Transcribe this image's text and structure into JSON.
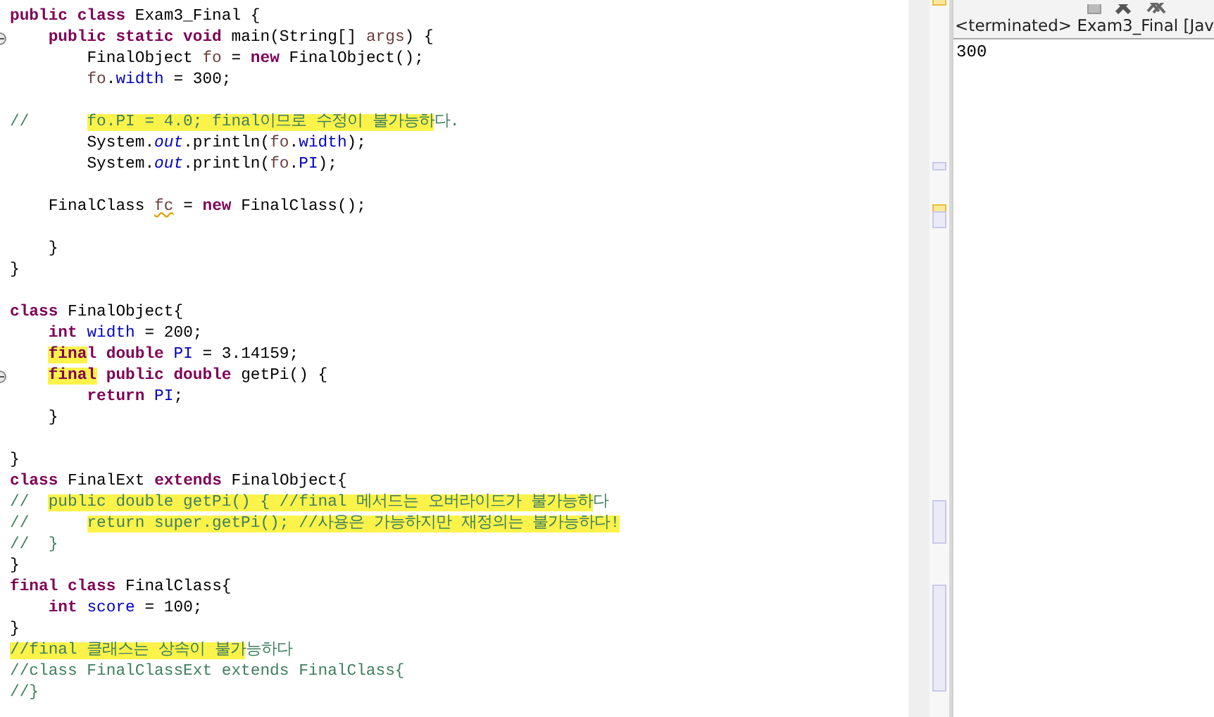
{
  "editor": {
    "lines": [
      {
        "kind": "code",
        "fold": false,
        "segments": [
          {
            "kind": "keyword",
            "text": "public class",
            "highlighted": false
          },
          {
            "kind": "plain",
            "text": " Exam3_Final {",
            "highlighted": false
          }
        ]
      },
      {
        "kind": "code",
        "fold": true,
        "segments": [
          {
            "kind": "keyword",
            "text": "    public static void",
            "highlighted": false
          },
          {
            "kind": "plain",
            "text": " main(String[] ",
            "highlighted": false
          },
          {
            "kind": "local",
            "text": "args",
            "highlighted": false
          },
          {
            "kind": "plain",
            "text": ") {",
            "highlighted": false
          }
        ]
      },
      {
        "kind": "code",
        "fold": false,
        "segments": [
          {
            "kind": "plain",
            "text": "        FinalObject ",
            "highlighted": false
          },
          {
            "kind": "local",
            "text": "fo",
            "highlighted": false
          },
          {
            "kind": "plain",
            "text": " = ",
            "highlighted": false
          },
          {
            "kind": "keyword",
            "text": "new",
            "highlighted": false
          },
          {
            "kind": "plain",
            "text": " FinalObject();",
            "highlighted": false
          }
        ]
      },
      {
        "kind": "code",
        "fold": false,
        "segments": [
          {
            "kind": "local",
            "text": "        fo",
            "highlighted": false
          },
          {
            "kind": "plain",
            "text": ".",
            "highlighted": false
          },
          {
            "kind": "field",
            "text": "width",
            "highlighted": false
          },
          {
            "kind": "plain",
            "text": " = 300;",
            "highlighted": false
          }
        ]
      },
      {
        "kind": "blank"
      },
      {
        "kind": "code",
        "fold": false,
        "segments": [
          {
            "kind": "comment",
            "text": "//",
            "highlighted": false
          },
          {
            "kind": "comment",
            "text": "      fo.PI = 4.0; final이므로 수정이 불가능하",
            "highlighted": true
          },
          {
            "kind": "comment",
            "text": "다.",
            "highlighted": false
          }
        ]
      },
      {
        "kind": "code",
        "fold": false,
        "segments": [
          {
            "kind": "plain",
            "text": "        System.",
            "highlighted": false
          },
          {
            "kind": "static",
            "text": "out",
            "highlighted": false
          },
          {
            "kind": "plain",
            "text": ".println(",
            "highlighted": false
          },
          {
            "kind": "local",
            "text": "fo",
            "highlighted": false
          },
          {
            "kind": "plain",
            "text": ".",
            "highlighted": false
          },
          {
            "kind": "field",
            "text": "width",
            "highlighted": false
          },
          {
            "kind": "plain",
            "text": ");",
            "highlighted": false
          }
        ]
      },
      {
        "kind": "code",
        "fold": false,
        "segments": [
          {
            "kind": "plain",
            "text": "        System.",
            "highlighted": false
          },
          {
            "kind": "static",
            "text": "out",
            "highlighted": false
          },
          {
            "kind": "plain",
            "text": ".println(",
            "highlighted": false
          },
          {
            "kind": "local",
            "text": "fo",
            "highlighted": false
          },
          {
            "kind": "plain",
            "text": ".",
            "highlighted": false
          },
          {
            "kind": "field",
            "text": "PI",
            "highlighted": false
          },
          {
            "kind": "plain",
            "text": ");",
            "highlighted": false
          }
        ]
      },
      {
        "kind": "blank"
      },
      {
        "kind": "code",
        "fold": false,
        "segments": [
          {
            "kind": "plain",
            "text": "    FinalClass ",
            "highlighted": false
          },
          {
            "kind": "warning",
            "text": "fc",
            "highlighted": false
          },
          {
            "kind": "plain",
            "text": " = ",
            "highlighted": false
          },
          {
            "kind": "keyword",
            "text": "new",
            "highlighted": false
          },
          {
            "kind": "plain",
            "text": " FinalClass();",
            "highlighted": false
          }
        ]
      },
      {
        "kind": "blank"
      },
      {
        "kind": "code",
        "fold": false,
        "segments": [
          {
            "kind": "plain",
            "text": "    }",
            "highlighted": false
          }
        ]
      },
      {
        "kind": "code",
        "fold": false,
        "segments": [
          {
            "kind": "plain",
            "text": "}",
            "highlighted": false
          }
        ]
      },
      {
        "kind": "blank"
      },
      {
        "kind": "code",
        "fold": false,
        "segments": [
          {
            "kind": "keyword",
            "text": "class",
            "highlighted": false
          },
          {
            "kind": "plain",
            "text": " FinalObject{",
            "highlighted": false
          }
        ]
      },
      {
        "kind": "code",
        "fold": false,
        "segments": [
          {
            "kind": "keyword",
            "text": "    int",
            "highlighted": false
          },
          {
            "kind": "field",
            "text": " width",
            "highlighted": false
          },
          {
            "kind": "plain",
            "text": " = 200;",
            "highlighted": false
          }
        ]
      },
      {
        "kind": "code",
        "fold": false,
        "segments": [
          {
            "kind": "keyword",
            "text": "    fina",
            "highlighted": true
          },
          {
            "kind": "keyword",
            "text": "l",
            "highlighted": false
          },
          {
            "kind": "keyword",
            "text": " double",
            "highlighted": false
          },
          {
            "kind": "field",
            "text": " PI",
            "highlighted": false
          },
          {
            "kind": "plain",
            "text": " = 3.14159;",
            "highlighted": false
          }
        ]
      },
      {
        "kind": "code",
        "fold": true,
        "segments": [
          {
            "kind": "keyword",
            "text": "    final",
            "highlighted": true
          },
          {
            "kind": "keyword",
            "text": " public double",
            "highlighted": false
          },
          {
            "kind": "plain",
            "text": " getPi() {",
            "highlighted": false
          }
        ]
      },
      {
        "kind": "code",
        "fold": false,
        "segments": [
          {
            "kind": "keyword",
            "text": "        return",
            "highlighted": false
          },
          {
            "kind": "field",
            "text": " PI",
            "highlighted": false
          },
          {
            "kind": "plain",
            "text": ";",
            "highlighted": false
          }
        ]
      },
      {
        "kind": "code",
        "fold": false,
        "segments": [
          {
            "kind": "plain",
            "text": "    }",
            "highlighted": false
          }
        ]
      },
      {
        "kind": "blank"
      },
      {
        "kind": "code",
        "fold": false,
        "segments": [
          {
            "kind": "plain",
            "text": "}",
            "highlighted": false
          }
        ]
      },
      {
        "kind": "code",
        "fold": false,
        "segments": [
          {
            "kind": "keyword",
            "text": "class",
            "highlighted": false
          },
          {
            "kind": "plain",
            "text": " FinalExt ",
            "highlighted": false
          },
          {
            "kind": "keyword",
            "text": "extends",
            "highlighted": false
          },
          {
            "kind": "plain",
            "text": " FinalObject{",
            "highlighted": false
          }
        ]
      },
      {
        "kind": "code",
        "fold": false,
        "segments": [
          {
            "kind": "comment",
            "text": "//",
            "highlighted": false
          },
          {
            "kind": "comment",
            "text": "  public double getPi() { //final 메서드는 오버라이드가 불가능하",
            "highlighted": true
          },
          {
            "kind": "comment",
            "text": "다",
            "highlighted": false
          }
        ]
      },
      {
        "kind": "code",
        "fold": false,
        "segments": [
          {
            "kind": "comment",
            "text": "//",
            "highlighted": false
          },
          {
            "kind": "comment",
            "text": "      return super.getPi(); //사용은 가능하지만 재정의는 불가능하다!",
            "highlighted": true
          }
        ]
      },
      {
        "kind": "code",
        "fold": false,
        "segments": [
          {
            "kind": "comment",
            "text": "//  }",
            "highlighted": false
          }
        ]
      },
      {
        "kind": "code",
        "fold": false,
        "segments": [
          {
            "kind": "plain",
            "text": "}",
            "highlighted": false
          }
        ]
      },
      {
        "kind": "code",
        "fold": false,
        "segments": [
          {
            "kind": "keyword",
            "text": "final class",
            "highlighted": false
          },
          {
            "kind": "plain",
            "text": " FinalClass{",
            "highlighted": false
          }
        ]
      },
      {
        "kind": "code",
        "fold": false,
        "segments": [
          {
            "kind": "keyword",
            "text": "    int",
            "highlighted": false
          },
          {
            "kind": "field",
            "text": " score",
            "highlighted": false
          },
          {
            "kind": "plain",
            "text": " = 100;",
            "highlighted": false
          }
        ]
      },
      {
        "kind": "code",
        "fold": false,
        "segments": [
          {
            "kind": "plain",
            "text": "}",
            "highlighted": false
          }
        ]
      },
      {
        "kind": "code",
        "fold": false,
        "segments": [
          {
            "kind": "comment",
            "text": "//final 클래스는 상속이 불가",
            "highlighted": true
          },
          {
            "kind": "comment",
            "text": "능하다",
            "highlighted": false
          }
        ]
      },
      {
        "kind": "code",
        "fold": false,
        "segments": [
          {
            "kind": "comment",
            "text": "//class FinalClassExt extends FinalClass{",
            "highlighted": false
          }
        ]
      },
      {
        "kind": "code",
        "fold": false,
        "segments": [
          {
            "kind": "comment",
            "text": "//}",
            "highlighted": false
          }
        ]
      }
    ]
  },
  "console": {
    "label": "<terminated> Exam3_Final [Jav",
    "output": [
      "300"
    ]
  }
}
